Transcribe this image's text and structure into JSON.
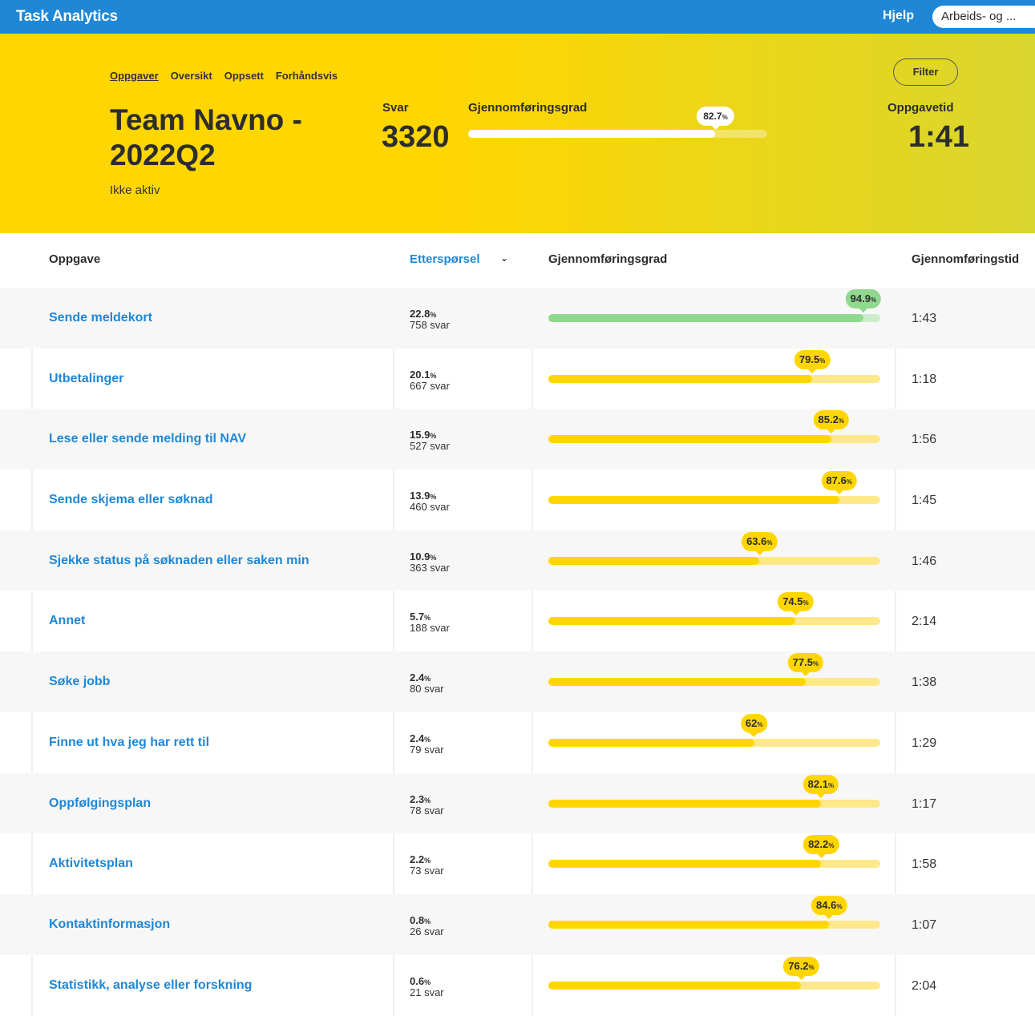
{
  "header": {
    "brand": "Task Analytics",
    "help": "Hjelp",
    "org_select": "Arbeids- og ..."
  },
  "hero": {
    "tabs": [
      {
        "label": "Oppgaver",
        "active": true
      },
      {
        "label": "Oversikt",
        "active": false
      },
      {
        "label": "Oppsett",
        "active": false
      },
      {
        "label": "Forhåndsvis",
        "active": false
      }
    ],
    "title": "Team Navno - 2022Q2",
    "status": "Ikke aktiv",
    "svar_label": "Svar",
    "svar_value": "3320",
    "completion_label": "Gjennomføringsgrad",
    "completion_value": 82.7,
    "completion_text": "82.7",
    "task_time_label": "Oppgavetid",
    "task_time_value": "1:41",
    "filter_label": "Filter"
  },
  "table": {
    "headers": {
      "task": "Oppgave",
      "demand": "Etterspørsel",
      "completion": "Gjennomføringsgrad",
      "time": "Gjennomføringstid"
    },
    "percent_unit": "%",
    "rows": [
      {
        "task": "Sende meldekort",
        "demand": "22.8",
        "count": "758 svar",
        "completion": 94.9,
        "completion_text": "94.9",
        "time": "1:43",
        "color": "#8fd98f",
        "track": "#cdeecd"
      },
      {
        "task": "Utbetalinger",
        "demand": "20.1",
        "count": "667 svar",
        "completion": 79.5,
        "completion_text": "79.5",
        "time": "1:18",
        "color": "#ffd600",
        "track": "#ffe88a"
      },
      {
        "task": "Lese eller sende melding til NAV",
        "demand": "15.9",
        "count": "527 svar",
        "completion": 85.2,
        "completion_text": "85.2",
        "time": "1:56",
        "color": "#ffd600",
        "track": "#ffe88a"
      },
      {
        "task": "Sende skjema eller søknad",
        "demand": "13.9",
        "count": "460 svar",
        "completion": 87.6,
        "completion_text": "87.6",
        "time": "1:45",
        "color": "#ffd600",
        "track": "#ffe88a"
      },
      {
        "task": "Sjekke status på søknaden eller saken min",
        "demand": "10.9",
        "count": "363 svar",
        "completion": 63.6,
        "completion_text": "63.6",
        "time": "1:46",
        "color": "#ffd600",
        "track": "#ffe88a"
      },
      {
        "task": "Annet",
        "demand": "5.7",
        "count": "188 svar",
        "completion": 74.5,
        "completion_text": "74.5",
        "time": "2:14",
        "color": "#ffd600",
        "track": "#ffe88a"
      },
      {
        "task": "Søke jobb",
        "demand": "2.4",
        "count": "80 svar",
        "completion": 77.5,
        "completion_text": "77.5",
        "time": "1:38",
        "color": "#ffd600",
        "track": "#ffe88a"
      },
      {
        "task": "Finne ut hva jeg har rett til",
        "demand": "2.4",
        "count": "79 svar",
        "completion": 62,
        "completion_text": "62",
        "time": "1:29",
        "color": "#ffd600",
        "track": "#ffe88a"
      },
      {
        "task": "Oppfølgingsplan",
        "demand": "2.3",
        "count": "78 svar",
        "completion": 82.1,
        "completion_text": "82.1",
        "time": "1:17",
        "color": "#ffd600",
        "track": "#ffe88a"
      },
      {
        "task": "Aktivitetsplan",
        "demand": "2.2",
        "count": "73 svar",
        "completion": 82.2,
        "completion_text": "82.2",
        "time": "1:58",
        "color": "#ffd600",
        "track": "#ffe88a"
      },
      {
        "task": "Kontaktinformasjon",
        "demand": "0.8",
        "count": "26 svar",
        "completion": 84.6,
        "completion_text": "84.6",
        "time": "1:07",
        "color": "#ffd600",
        "track": "#ffe88a"
      },
      {
        "task": "Statistikk, analyse eller forskning",
        "demand": "0.6",
        "count": "21 svar",
        "completion": 76.2,
        "completion_text": "76.2",
        "time": "2:04",
        "color": "#ffd600",
        "track": "#ffe88a"
      }
    ]
  }
}
